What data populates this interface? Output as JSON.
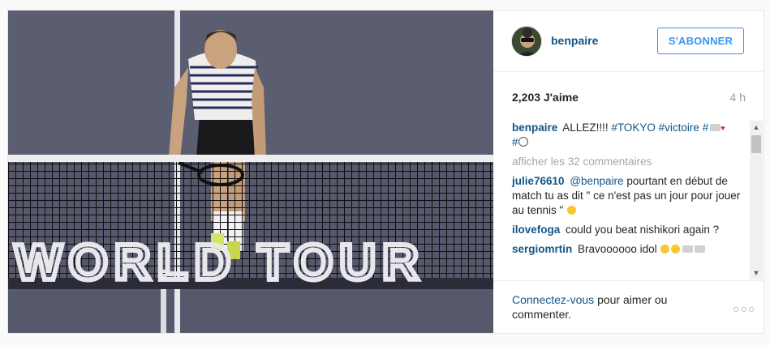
{
  "post": {
    "image_alt": "Tennis player leaning on the net, WORLD TOUR lettering"
  },
  "header": {
    "username": "benpaire",
    "follow_label": "S'ABONNER"
  },
  "meta": {
    "likes": "2,203 J'aime",
    "time": "4 h"
  },
  "caption": {
    "user": "benpaire",
    "text": "ALLEZ!!!!",
    "tag1": "#TOKYO",
    "tag2": "#victoire",
    "tag3": "#",
    "tag4": "#"
  },
  "comments": {
    "view_all": "afficher les 32 commentaires",
    "items": [
      {
        "user": "julie76610",
        "mention": "@benpaire",
        "text": "pourtant en début de match tu as dit \" ce n'est pas un jour pour jouer au tennis \""
      },
      {
        "user": "ilovefoga",
        "text": "could you beat nishikori again ?"
      },
      {
        "user": "sergiomrtin",
        "text": "Bravoooooo idol"
      }
    ]
  },
  "footer": {
    "login_link": "Connectez-vous",
    "login_rest": "pour aimer ou commenter.",
    "options": "○○○"
  },
  "net_text": "WORLD TOUR",
  "colors": {
    "link": "#125688",
    "button": "#3897f0",
    "court": "#56596b"
  }
}
